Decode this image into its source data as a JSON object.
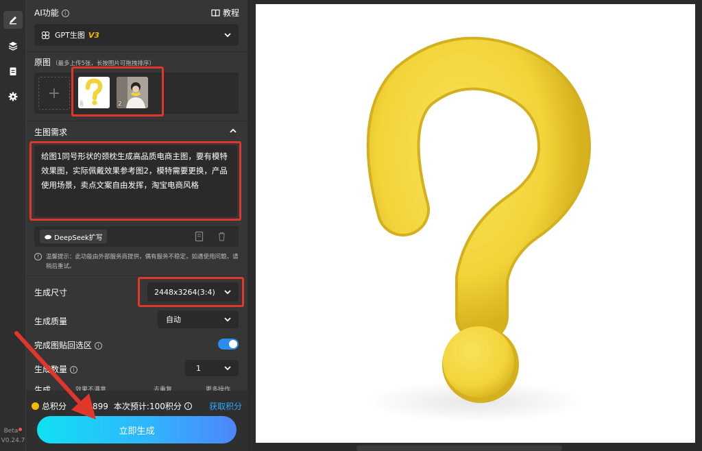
{
  "rail": {
    "items": [
      {
        "name": "edit",
        "icon": "pencil-icon",
        "active": true
      },
      {
        "name": "layers",
        "icon": "layers-icon",
        "active": false
      },
      {
        "name": "notes",
        "icon": "clipboard-icon",
        "active": false
      },
      {
        "name": "settings",
        "icon": "gear-icon",
        "active": false
      }
    ],
    "beta_label": "Beta",
    "version": "V0.24.7"
  },
  "ai": {
    "title": "AI功能",
    "tutorial_label": "教程",
    "model_name": "GPT生图",
    "model_version": "V3"
  },
  "source": {
    "title": "原图",
    "hint": "（最多上传5张，长按图片可拖拽排序）",
    "add_symbol": "+",
    "thumbs": [
      {
        "index": "1"
      },
      {
        "index": "2"
      }
    ]
  },
  "prompt": {
    "title": "生图需求",
    "text": "给图1同号形状的颈枕生成高品质电商主图，要有模特效果图，实际佩戴效果参考图2，模特需要更换，产品使用场景，卖点文案自由发挥，淘宝电商风格",
    "expand_label": "DeepSeek扩写",
    "notice": "温馨提示：此功能由外部服务商提供，偶有服务不稳定，如遇使用问题，请稍后重试。"
  },
  "settings": {
    "size_label": "生成尺寸",
    "size_value": "2448x3264(3:4)",
    "quality_label": "生成质量",
    "quality_value": "自动",
    "paste_label": "完成图贴回选区",
    "paste_on": true,
    "count_label": "生成数量",
    "count_value": "1",
    "partial_label": "生成",
    "partial_options": [
      "效果不满意",
      "去重复",
      "更多操作"
    ]
  },
  "footer": {
    "points_label": "总积分",
    "points_value": "899",
    "estimate": "本次预计:100积分",
    "get_points": "获取积分",
    "generate_label": "立即生成"
  },
  "colors": {
    "accent_red": "#e0362b",
    "model_version": "#f5b800",
    "link_blue": "#2da8ff",
    "toggle_on": "#2d8cf0",
    "gradient_start": "#11e0f2",
    "gradient_end": "#4d86f7",
    "product_yellow": "#f2d43a"
  }
}
